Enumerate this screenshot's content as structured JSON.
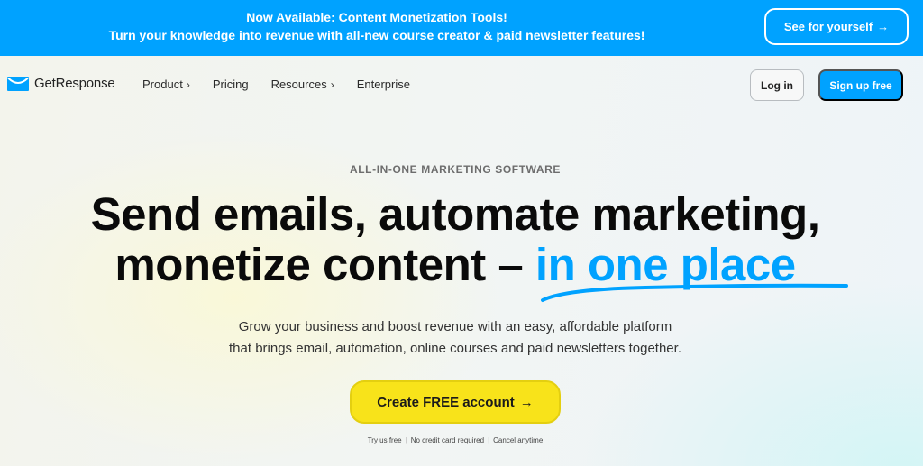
{
  "promo_banner": {
    "title": "Now Available: Content Monetization Tools!",
    "subtitle": "Turn your knowledge into revenue with all-new course creator & paid newsletter features!",
    "cta_label": "See for yourself",
    "cta_icon": "arrow-right-icon",
    "background_color": "#00a2ff"
  },
  "nav": {
    "brand": "GetResponse",
    "logo_icon": "envelope-smile-icon",
    "items": [
      {
        "label": "Product",
        "has_submenu": true
      },
      {
        "label": "Pricing",
        "has_submenu": false
      },
      {
        "label": "Resources",
        "has_submenu": true
      },
      {
        "label": "Enterprise",
        "has_submenu": false
      }
    ],
    "submenu_glyph": "›",
    "login_label": "Log in",
    "signup_label": "Sign up free"
  },
  "hero": {
    "eyebrow": "ALL-IN-ONE MARKETING SOFTWARE",
    "headline_line1": "Send emails, automate marketing,",
    "headline_line2_prefix": "monetize content – ",
    "headline_accent": "in one place",
    "subtext_line1": "Grow your business and boost revenue with an easy, affordable platform",
    "subtext_line2": "that brings email, automation, online courses and paid newsletters together.",
    "cta_label": "Create FREE account",
    "cta_icon": "arrow-right-icon",
    "fineprint": [
      "Try us free",
      "No credit card required",
      "Cancel anytime"
    ],
    "accent_color": "#00a2ff",
    "cta_color": "#f8e31a"
  },
  "arrow_glyph": "→"
}
